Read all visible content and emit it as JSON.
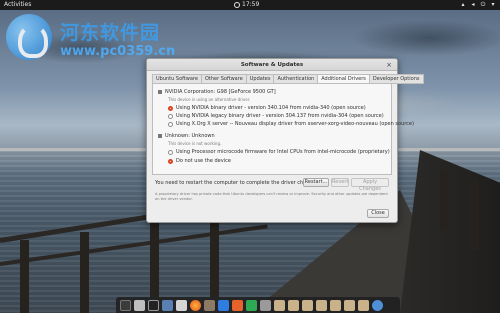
{
  "topbar": {
    "activities": "Activities",
    "clock": "17:59"
  },
  "watermark": {
    "name": "河东软件园",
    "url": "www.pc0359.cn"
  },
  "dialog": {
    "title": "Software & Updates",
    "tabs": [
      {
        "label": "Ubuntu Software"
      },
      {
        "label": "Other Software"
      },
      {
        "label": "Updates"
      },
      {
        "label": "Authentication"
      },
      {
        "label": "Additional Drivers",
        "active": true
      },
      {
        "label": "Developer Options"
      }
    ],
    "devices": [
      {
        "name": "NVIDIA Corporation: G98 [GeForce 9500 GT]",
        "note": "This device is using an alternative driver.",
        "options": [
          {
            "label": "Using NVIDIA binary driver - version 340.104 from nvidia-340 (open source)",
            "selected": true
          },
          {
            "label": "Using NVIDIA legacy binary driver - version 304.137 from nvidia-304 (open source)",
            "selected": false
          },
          {
            "label": "Using X.Org X server -- Nouveau display driver from xserver-xorg-video-nouveau (open source)",
            "selected": false
          }
        ]
      },
      {
        "name": "Unknown: Unknown",
        "note": "This device is not working.",
        "options": [
          {
            "label": "Using Processor microcode firmware for Intel CPUs from intel-microcode (proprietary)",
            "selected": false
          },
          {
            "label": "Do not use the device",
            "selected": true
          }
        ]
      }
    ],
    "restart_text": "You need to restart the computer to complete the driver changes.",
    "buttons": {
      "restart": "Restart...",
      "revert": "Revert",
      "apply": "Apply Changes",
      "close": "Close"
    },
    "footnote": "A proprietary driver has private code that Ubuntu developers can't review or improve. Security and other updates are dependent on the driver vendor."
  },
  "colors": {
    "accent": "#e04a26",
    "topbar": "#1b1b1b",
    "dialog_bg": "#ededed"
  },
  "dock": {
    "icons": [
      "grid-icon",
      "files-icon",
      "terminal-icon",
      "monitor-icon",
      "image-viewer-icon",
      "firefox-icon",
      "gimp-icon",
      "wps-writer-icon",
      "wps-presentation-icon",
      "wps-spreadsheet-icon",
      "app-icon",
      "folder-icon",
      "folder-icon",
      "folder-icon",
      "folder-icon",
      "folder-icon",
      "folder-icon",
      "folder-icon",
      "settings-icon"
    ]
  }
}
